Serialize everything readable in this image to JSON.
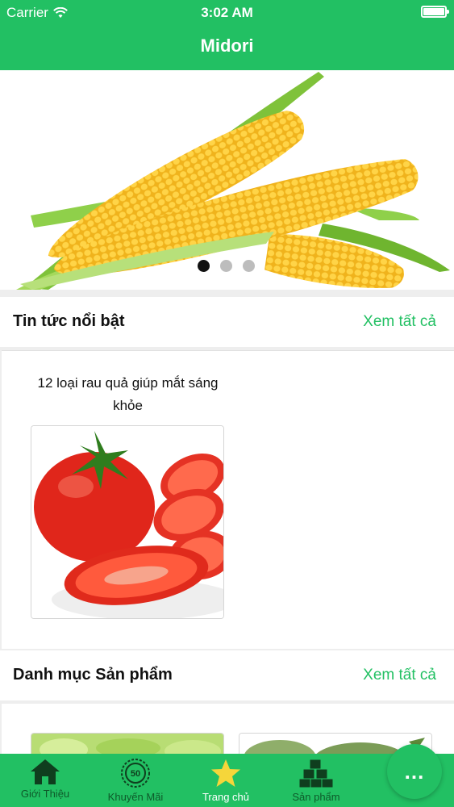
{
  "status_bar": {
    "carrier": "Carrier",
    "time": "3:02 AM"
  },
  "nav": {
    "title": "Midori"
  },
  "banner": {
    "slides": 3,
    "active_slide": 1
  },
  "news_section": {
    "title": "Tin tức nổi bật",
    "see_all": "Xem tất cả",
    "items": [
      {
        "caption": "12 loại rau quả giúp mắt sáng khỏe"
      }
    ]
  },
  "products_section": {
    "title": "Danh mục Sản phẩm",
    "see_all": "Xem tất cả"
  },
  "tabbar": {
    "tabs": [
      {
        "label": "Giới Thiệu",
        "icon": "home-icon"
      },
      {
        "label": "Khuyến Mãi",
        "icon": "discount-badge-icon"
      },
      {
        "label": "Trang chủ",
        "icon": "star-icon",
        "active": true
      },
      {
        "label": "Sản phẩm",
        "icon": "boxes-icon"
      }
    ]
  },
  "fab": {
    "label": "..."
  },
  "colors": {
    "brand_green": "#22c063",
    "active_tab_text": "#ffffff",
    "inactive_tab_text": "#0e5a2a"
  }
}
